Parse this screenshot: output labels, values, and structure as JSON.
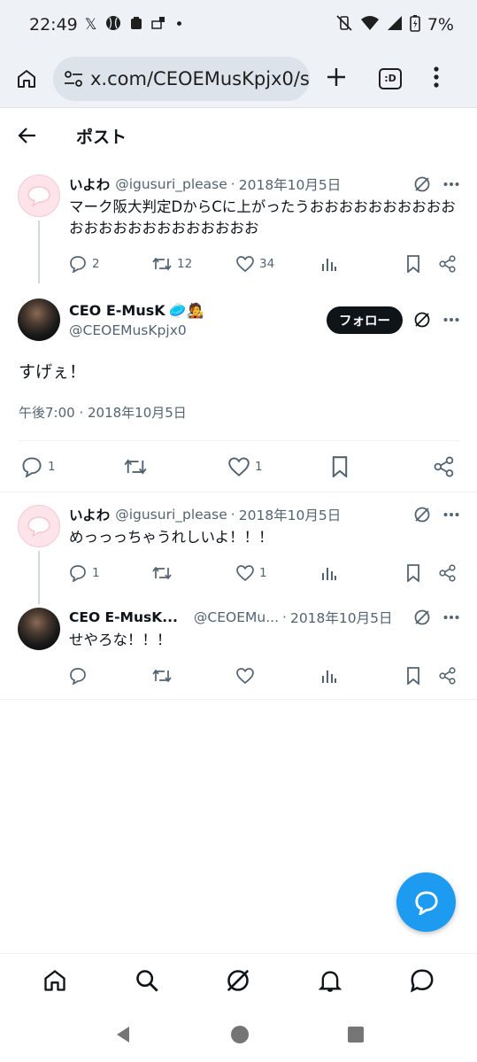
{
  "status_bar": {
    "time": "22:49",
    "battery": "7%",
    "notif_x": "𝕏"
  },
  "browser": {
    "url": "x.com/CEOEMusKpjx0/s",
    "tab_label": ":D"
  },
  "header": {
    "title": "ポスト"
  },
  "parent_tweet": {
    "name": "いよわ",
    "handle": "@igusuri_please",
    "sep": "·",
    "date": "2018年10月5日",
    "text": "マーク阪大判定DからCに上がったうおおおおおおおおおおおおおおおおおおおおおおお",
    "replies": "2",
    "retweets": "12",
    "likes": "34"
  },
  "focus_tweet": {
    "name": "CEO E-MusK",
    "name_emoji": "🥏🧑‍🎤",
    "handle": "@CEOEMusKpjx0",
    "follow_label": "フォロー",
    "text": "すげぇ！",
    "meta": "午後7:00 · 2018年10月5日",
    "replies": "1",
    "likes": "1"
  },
  "reply1": {
    "name": "いよわ",
    "handle": "@igusuri_please",
    "sep": "·",
    "date": "2018年10月5日",
    "text": "めっっっちゃうれしいよ！！！",
    "replies": "1",
    "likes": "1"
  },
  "reply2": {
    "name": "CEO E-MusK...",
    "handle": "@CEOEMu...",
    "sep": "·",
    "date": "2018年10月5日",
    "text": "せやろな！！！"
  },
  "colors": {
    "accent": "#1d9bf0",
    "muted": "#536471",
    "text": "#0f1419"
  }
}
